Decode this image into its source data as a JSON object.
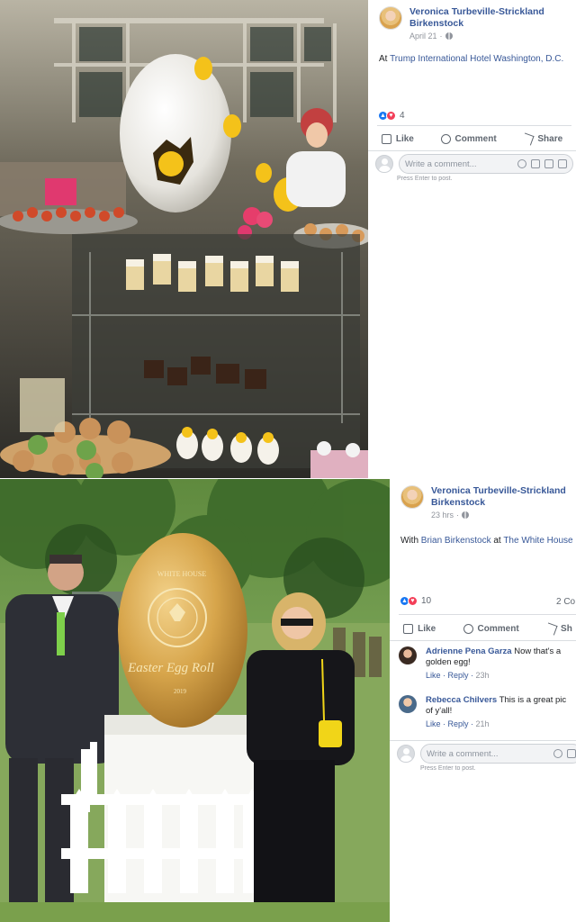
{
  "post1": {
    "author": "Veronica Turbeville-Strickland Birkenstock",
    "author_line1": "Veronica Turbeville-Strickland",
    "author_line2": "Birkenstock",
    "date": "April 21",
    "text_prefix": "At",
    "location": "Trump International Hotel Washington, D.C.",
    "reactions_count": "4",
    "actions": {
      "like": "Like",
      "comment": "Comment",
      "share": "Share"
    },
    "comment_placeholder": "Write a comment...",
    "hint": "Press Enter to post."
  },
  "post2": {
    "author_line1": "Veronica Turbeville-Strickland",
    "author_line2": "Birkenstock",
    "date": "23 hrs",
    "text_prefix": "With",
    "tagged": "Brian Birkenstock",
    "at": "at",
    "location": "The White House",
    "reactions_count": "10",
    "comments_count": "2 Co",
    "actions": {
      "like": "Like",
      "comment": "Comment",
      "share": "Sh"
    },
    "comments": [
      {
        "author": "Adrienne Pena Garza",
        "text": "Now that's a golden egg!",
        "like": "Like",
        "reply": "Reply",
        "time": "23h"
      },
      {
        "author": "Rebecca Chilvers",
        "text": "This is a great pic of y'all!",
        "like": "Like",
        "reply": "Reply",
        "time": "21h"
      }
    ],
    "comment_placeholder": "Write a comment...",
    "hint": "Press Enter to post."
  },
  "egg_text": {
    "top": "WHITE HOUSE",
    "script": "Easter Egg Roll",
    "year": "2019"
  },
  "colors": {
    "link": "#385898",
    "like": "#1877f2",
    "love": "#f33e58",
    "gold": "#c8963a"
  }
}
